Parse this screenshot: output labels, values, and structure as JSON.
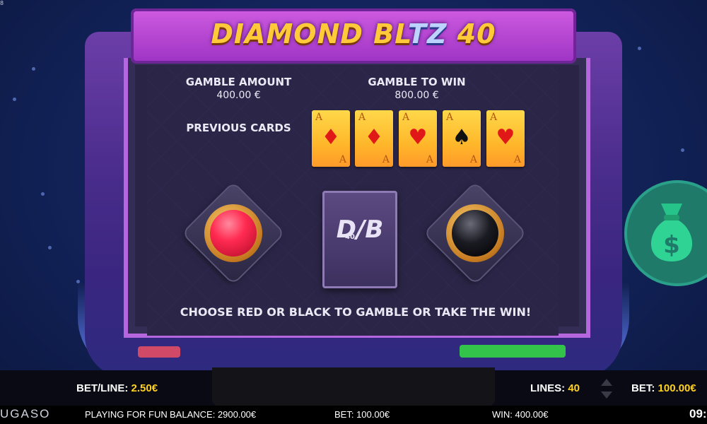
{
  "game": {
    "title_part1": "DIAMOND BL",
    "title_part2": "TZ",
    "title_part3": " 40"
  },
  "gamble": {
    "amount_label": "GAMBLE AMOUNT",
    "amount_value": "400.00 €",
    "to_win_label": "GAMBLE TO WIN",
    "to_win_value": "800.00 €",
    "previous_label": "PREVIOUS CARDS",
    "previous_cards": [
      {
        "rank": "A",
        "suit": "♦",
        "color": "red"
      },
      {
        "rank": "A",
        "suit": "♦",
        "color": "red"
      },
      {
        "rank": "A",
        "suit": "♥",
        "color": "red"
      },
      {
        "rank": "A",
        "suit": "♠",
        "color": "black"
      },
      {
        "rank": "A",
        "suit": "♥",
        "color": "red"
      }
    ],
    "card_back_logo": "D/B",
    "card_back_sub": "40",
    "instruction": "CHOOSE RED OR BLACK TO GAMBLE OR TAKE THE WIN!"
  },
  "controls": {
    "bet_line_label": "BET/LINE:",
    "bet_line_value": "2.50€",
    "lines_label": "LINES:",
    "lines_value": "40",
    "bet_label": "BET:",
    "bet_value": "100.00€"
  },
  "status": {
    "brand": "UGASO",
    "mode": "PLAYING FOR FUN",
    "balance": "BALANCE: 2900.00€",
    "bet": "BET: 100.00€",
    "win": "WIN: 400.00€",
    "clock": "09:",
    "corner": "8"
  },
  "colors": {
    "accent_yellow": "#ffd21e",
    "red_button": "#ff2a50",
    "collect_green": "#1f7a6a"
  },
  "icons": {
    "collect": "money-bag-icon"
  }
}
